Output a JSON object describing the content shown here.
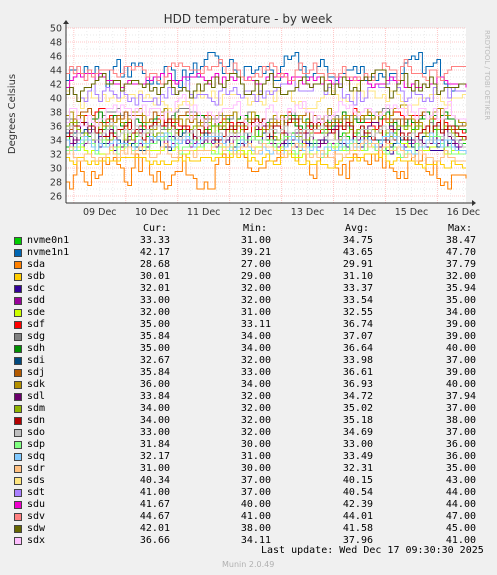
{
  "chart_data": {
    "type": "line",
    "title": "HDD temperature - by week",
    "ylabel": "Degrees Celsius",
    "side_label": "RRDTOOL / TOBI OETIKER",
    "ylim": [
      25,
      50
    ],
    "yticks": [
      26,
      28,
      30,
      32,
      34,
      36,
      38,
      40,
      42,
      44,
      46,
      48,
      50
    ],
    "xticks": [
      "09 Dec",
      "10 Dec",
      "11 Dec",
      "12 Dec",
      "13 Dec",
      "14 Dec",
      "15 Dec",
      "16 Dec"
    ],
    "grid": true,
    "columns": [
      "Cur:",
      "Min:",
      "Avg:",
      "Max:"
    ],
    "series": [
      {
        "name": "nvme0n1",
        "color": "#00cc00",
        "cur": "33.33",
        "min": "31.00",
        "avg": "34.75",
        "max": "38.47"
      },
      {
        "name": "nvme1n1",
        "color": "#0066b3",
        "cur": "42.17",
        "min": "39.21",
        "avg": "43.65",
        "max": "47.70"
      },
      {
        "name": "sda",
        "color": "#ff8000",
        "cur": "28.68",
        "min": "27.00",
        "avg": "29.91",
        "max": "37.79"
      },
      {
        "name": "sdb",
        "color": "#ffcc00",
        "cur": "30.01",
        "min": "29.00",
        "avg": "31.10",
        "max": "32.00"
      },
      {
        "name": "sdc",
        "color": "#330099",
        "cur": "32.01",
        "min": "32.00",
        "avg": "33.37",
        "max": "35.94"
      },
      {
        "name": "sdd",
        "color": "#990099",
        "cur": "33.00",
        "min": "32.00",
        "avg": "33.54",
        "max": "35.00"
      },
      {
        "name": "sde",
        "color": "#ccff00",
        "cur": "32.00",
        "min": "31.00",
        "avg": "32.55",
        "max": "34.00"
      },
      {
        "name": "sdf",
        "color": "#ff0000",
        "cur": "35.00",
        "min": "33.11",
        "avg": "36.74",
        "max": "39.00"
      },
      {
        "name": "sdg",
        "color": "#808080",
        "cur": "35.84",
        "min": "34.00",
        "avg": "37.07",
        "max": "39.00"
      },
      {
        "name": "sdh",
        "color": "#008f00",
        "cur": "35.00",
        "min": "34.00",
        "avg": "36.64",
        "max": "40.00"
      },
      {
        "name": "sdi",
        "color": "#00487d",
        "cur": "32.67",
        "min": "32.00",
        "avg": "33.98",
        "max": "37.00"
      },
      {
        "name": "sdj",
        "color": "#b35a00",
        "cur": "35.84",
        "min": "33.00",
        "avg": "36.61",
        "max": "39.00"
      },
      {
        "name": "sdk",
        "color": "#b38f00",
        "cur": "36.00",
        "min": "34.00",
        "avg": "36.93",
        "max": "40.00"
      },
      {
        "name": "sdl",
        "color": "#6b006b",
        "cur": "33.84",
        "min": "32.00",
        "avg": "34.72",
        "max": "37.94"
      },
      {
        "name": "sdm",
        "color": "#8fb300",
        "cur": "34.00",
        "min": "32.00",
        "avg": "35.02",
        "max": "37.00"
      },
      {
        "name": "sdn",
        "color": "#b30000",
        "cur": "34.00",
        "min": "32.00",
        "avg": "35.18",
        "max": "38.00"
      },
      {
        "name": "sdo",
        "color": "#bebebe",
        "cur": "33.00",
        "min": "32.00",
        "avg": "34.69",
        "max": "37.00"
      },
      {
        "name": "sdp",
        "color": "#80ff80",
        "cur": "31.84",
        "min": "30.00",
        "avg": "33.00",
        "max": "36.00"
      },
      {
        "name": "sdq",
        "color": "#80c9ff",
        "cur": "32.17",
        "min": "31.00",
        "avg": "33.49",
        "max": "36.00"
      },
      {
        "name": "sdr",
        "color": "#ffc080",
        "cur": "31.00",
        "min": "30.00",
        "avg": "32.31",
        "max": "35.00"
      },
      {
        "name": "sds",
        "color": "#ffe680",
        "cur": "40.34",
        "min": "37.00",
        "avg": "40.15",
        "max": "43.00"
      },
      {
        "name": "sdt",
        "color": "#aa80ff",
        "cur": "41.00",
        "min": "37.00",
        "avg": "40.54",
        "max": "44.00"
      },
      {
        "name": "sdu",
        "color": "#ee00cc",
        "cur": "41.67",
        "min": "40.00",
        "avg": "42.39",
        "max": "44.00"
      },
      {
        "name": "sdv",
        "color": "#ff8080",
        "cur": "44.67",
        "min": "41.00",
        "avg": "44.01",
        "max": "47.00"
      },
      {
        "name": "sdw",
        "color": "#666600",
        "cur": "42.01",
        "min": "38.00",
        "avg": "41.58",
        "max": "45.00"
      },
      {
        "name": "sdx",
        "color": "#ffbfff",
        "cur": "36.66",
        "min": "34.11",
        "avg": "37.96",
        "max": "41.00"
      }
    ]
  },
  "footer": {
    "last_update": "Last update: Wed Dec 17 09:30:30 2025",
    "version": "Munin 2.0.49"
  }
}
